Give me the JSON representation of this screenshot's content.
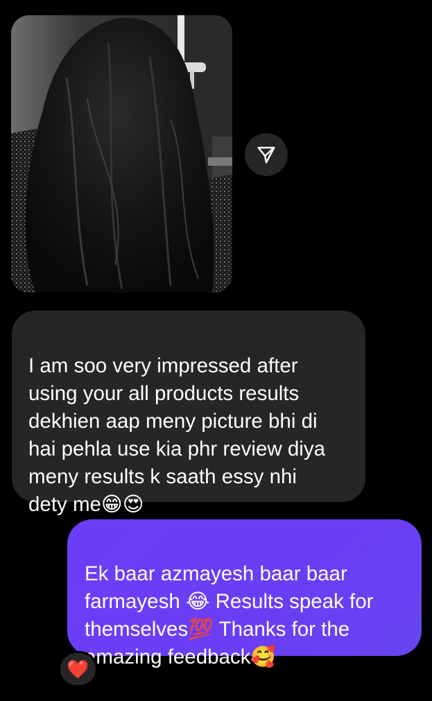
{
  "thread": {
    "photo_message": {
      "icon": "hair-photo"
    },
    "share_button": {
      "icon": "paper-plane-icon"
    },
    "received_message": {
      "text": "I am soo very impressed after\nusing your all products results\ndekhien aap meny picture bhi di\nhai pehla use kia phr review diya\nmeny results k saath essy nhi\ndety me😁😍"
    },
    "sent_message": {
      "text": "Ek baar azmayesh baar baar\nfarmayesh 😂 Results speak for\nthemselves💯 Thanks for the\namazing feedback🥰"
    },
    "reaction": {
      "emoji": "❤️"
    }
  },
  "colors": {
    "background": "#000000",
    "received_bubble": "#262626",
    "sent_bubble": "#6a3ef5",
    "text": "#ffffff"
  }
}
